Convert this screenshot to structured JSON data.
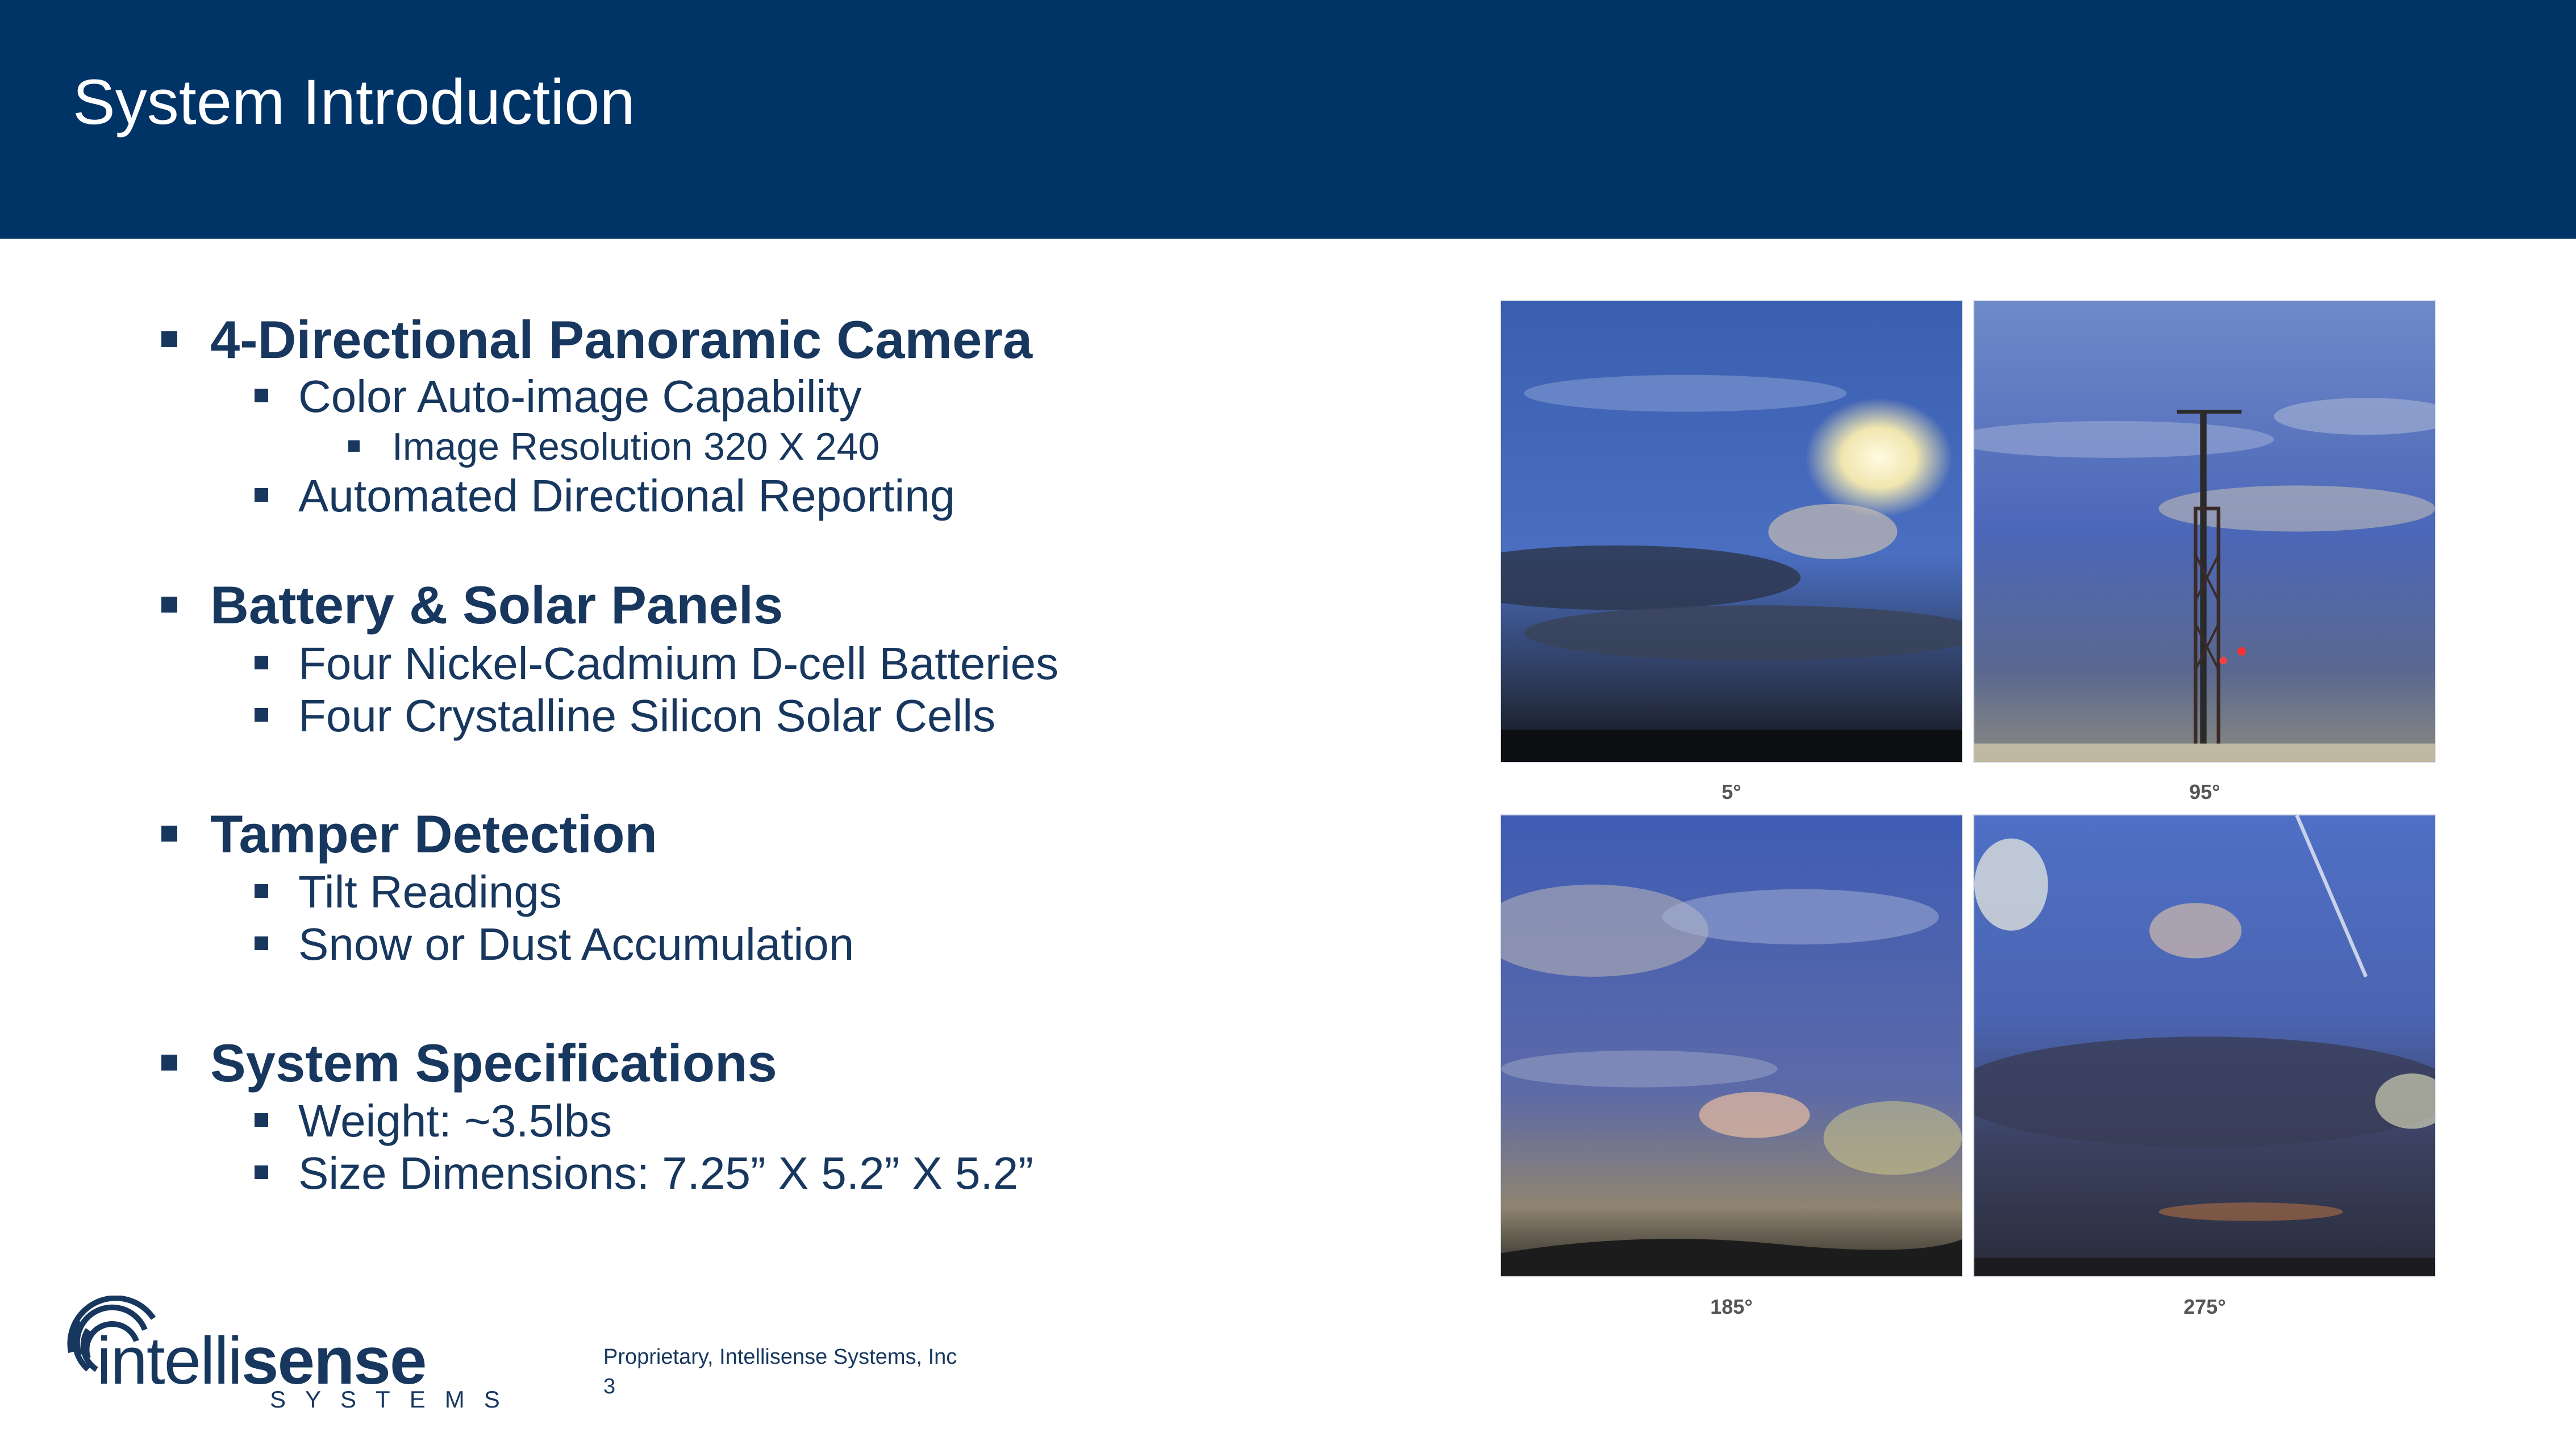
{
  "slide": {
    "title": "System Introduction",
    "sections": [
      {
        "heading": "4-Directional Panoramic Camera",
        "items": [
          "Color Auto-image Capability",
          "Automated Directional Reporting"
        ],
        "subitem": "Image Resolution 320 X 240"
      },
      {
        "heading": "Battery & Solar Panels",
        "items": [
          "Four Nickel-Cadmium D-cell Batteries",
          "Four Crystalline Silicon Solar Cells"
        ]
      },
      {
        "heading": "Tamper Detection",
        "items": [
          "Tilt Readings",
          "Snow or Dust Accumulation"
        ]
      },
      {
        "heading": "System Specifications",
        "items": [
          "Weight: ~3.5lbs",
          "Size Dimensions: 7.25” X 5.2” X 5.2”"
        ]
      }
    ],
    "images": [
      {
        "caption": "5°"
      },
      {
        "caption": "95°"
      },
      {
        "caption": "185°"
      },
      {
        "caption": "275°"
      }
    ]
  },
  "logo": {
    "word_prefix": "intelli",
    "word_suffix": "sense",
    "subtitle": "SYSTEMS"
  },
  "footer": {
    "proprietary": "Proprietary, Intellisense Systems, Inc",
    "page_number": "3"
  },
  "colors": {
    "header_bg": "#003366",
    "text": "#17375e"
  }
}
